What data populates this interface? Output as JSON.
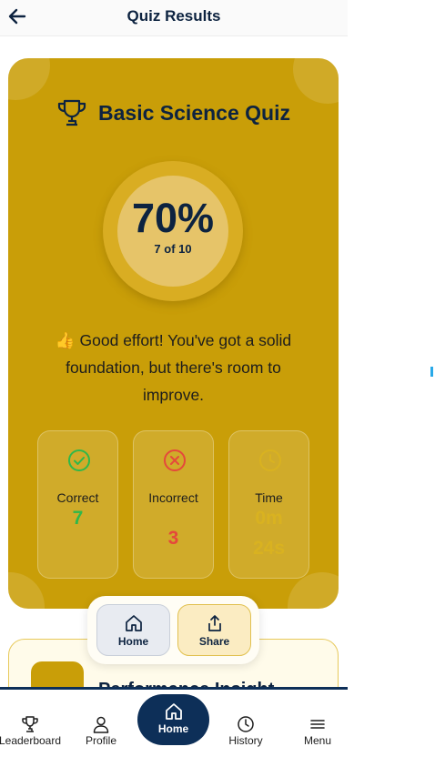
{
  "header": {
    "title": "Quiz Results",
    "back_icon": "arrow-left-icon"
  },
  "result": {
    "quiz_title": "Basic Science Quiz",
    "title_icon": "trophy-icon",
    "score_percent": "70%",
    "score_detail": "7 of 10",
    "feedback_emoji": "👍",
    "feedback_text": "Good effort! You've got a solid foundation, but there's room to improve."
  },
  "stats": {
    "correct": {
      "label": "Correct",
      "value": "7",
      "icon": "check-circle-icon",
      "color": "#2fb84a"
    },
    "incorrect": {
      "label": "Incorrect",
      "value": "3",
      "icon": "x-circle-icon",
      "color": "#e5483b"
    },
    "time": {
      "label": "Time",
      "value_line1": "0m",
      "value_line2": "24s",
      "icon": "clock-icon",
      "color": "#d9b220"
    }
  },
  "actions": {
    "home": {
      "label": "Home",
      "icon": "home-icon"
    },
    "share": {
      "label": "Share",
      "icon": "share-icon"
    }
  },
  "insight": {
    "title": "Performance Insight",
    "icon": "bar-chart-icon"
  },
  "bottom_nav": {
    "leaderboard": "Leaderboard",
    "profile": "Profile",
    "home": "Home",
    "history": "History",
    "menu": "Menu"
  },
  "colors": {
    "brand_gold": "#c99e08",
    "navy": "#0d2f58",
    "text_navy": "#0d2340"
  }
}
